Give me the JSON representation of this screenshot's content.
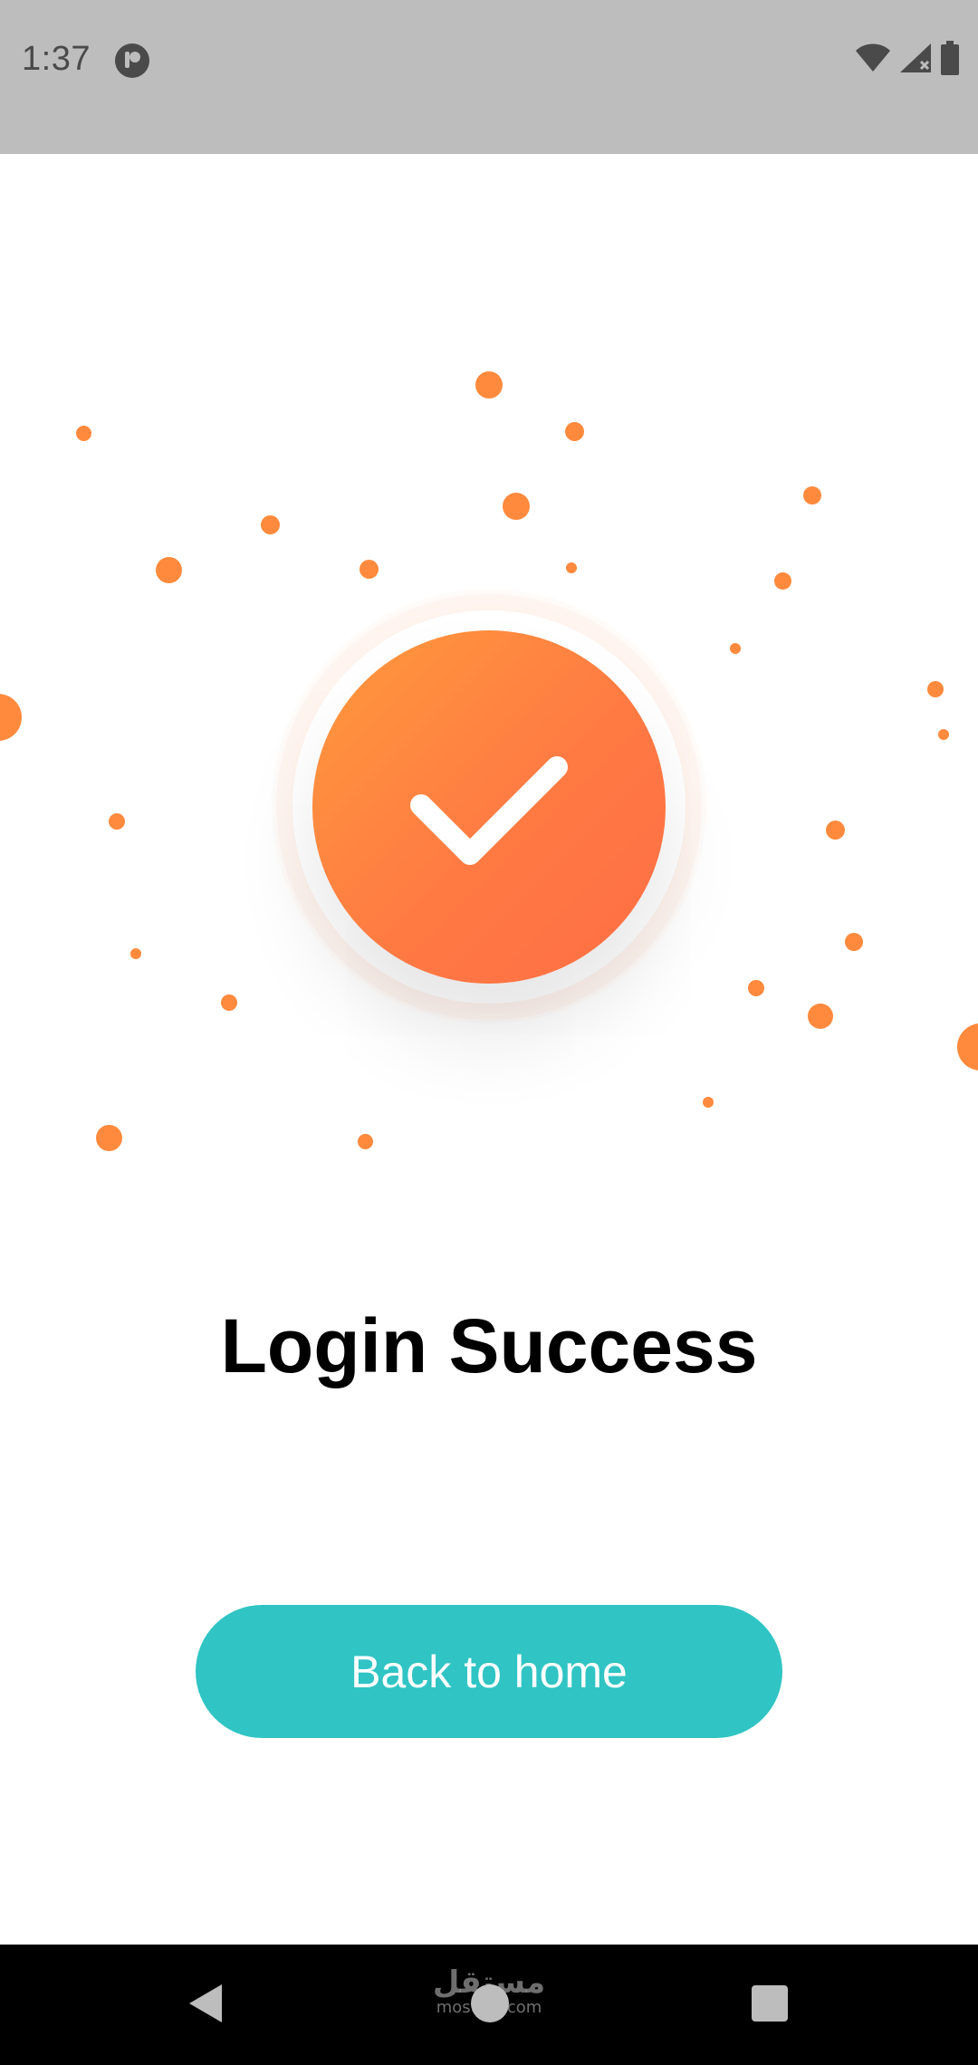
{
  "status_bar": {
    "time": "1:37",
    "background": "#bdbdbd",
    "icons": [
      "app-notification-icon",
      "wifi-icon",
      "signal-icon",
      "battery-icon"
    ]
  },
  "illustration": {
    "icon": "checkmark-icon",
    "accent_color": "#ff7d42"
  },
  "main": {
    "title": "Login Success",
    "button_label": "Back to home",
    "button_color": "#30c4c4"
  },
  "nav_bar": {
    "buttons": [
      "back-icon",
      "home-icon",
      "recents-icon"
    ]
  },
  "watermark": {
    "arabic": "مستقل",
    "latin": "mostaql.com"
  }
}
